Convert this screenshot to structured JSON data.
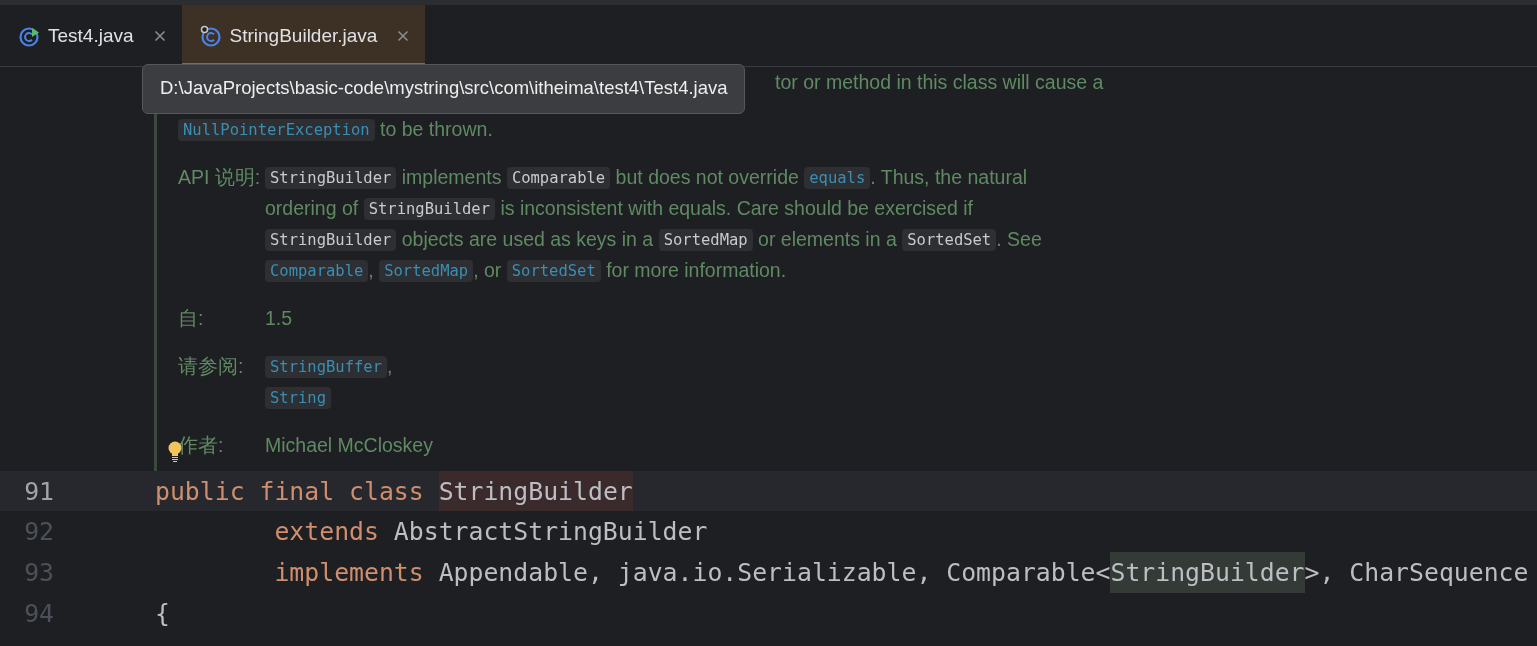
{
  "tabs": [
    {
      "label": "Test4.java",
      "selected": false
    },
    {
      "label": "StringBuilder.java",
      "selected": true
    }
  ],
  "tooltip": {
    "text": "D:\\JavaProjects\\basic-code\\mystring\\src\\com\\itheima\\test4\\Test4.java"
  },
  "doc": {
    "intro_lines": [
      [
        {
          "kind": "text",
          "text": "tor or method in this class will cause a"
        }
      ],
      [
        {
          "kind": "link",
          "text": "NullPointerException"
        },
        {
          "kind": "text",
          "text": " to be thrown."
        }
      ]
    ],
    "sections": [
      {
        "label": "API 说明:",
        "lines": [
          [
            {
              "kind": "code",
              "text": "StringBuilder"
            },
            {
              "kind": "text",
              "text": " implements "
            },
            {
              "kind": "code",
              "text": "Comparable"
            },
            {
              "kind": "text",
              "text": " but does not override "
            },
            {
              "kind": "link",
              "text": "equals"
            },
            {
              "kind": "text",
              "text": ". Thus, the natural"
            }
          ],
          [
            {
              "kind": "text",
              "text": "ordering of "
            },
            {
              "kind": "code",
              "text": "StringBuilder"
            },
            {
              "kind": "text",
              "text": " is inconsistent with equals. Care should be exercised if"
            }
          ],
          [
            {
              "kind": "code",
              "text": "StringBuilder"
            },
            {
              "kind": "text",
              "text": " objects are used as keys in a "
            },
            {
              "kind": "code",
              "text": "SortedMap"
            },
            {
              "kind": "text",
              "text": " or elements in a "
            },
            {
              "kind": "code",
              "text": "SortedSet"
            },
            {
              "kind": "text",
              "text": ". See"
            }
          ],
          [
            {
              "kind": "link",
              "text": "Comparable"
            },
            {
              "kind": "text",
              "text": ", "
            },
            {
              "kind": "link",
              "text": "SortedMap"
            },
            {
              "kind": "text",
              "text": ", or "
            },
            {
              "kind": "link",
              "text": "SortedSet"
            },
            {
              "kind": "text",
              "text": " for more information."
            }
          ]
        ]
      },
      {
        "label": "自:",
        "lines": [
          [
            {
              "kind": "text",
              "text": "1.5"
            }
          ]
        ]
      },
      {
        "label": "请参阅:",
        "lines": [
          [
            {
              "kind": "link",
              "text": "StringBuffer"
            },
            {
              "kind": "text",
              "text": ","
            }
          ],
          [
            {
              "kind": "link",
              "text": "String"
            }
          ]
        ]
      },
      {
        "label": "作者:",
        "lines": [
          [
            {
              "kind": "text",
              "text": "Michael McCloskey"
            }
          ]
        ]
      }
    ]
  },
  "code_lines": [
    {
      "number": "91",
      "current": true,
      "tokens": [
        {
          "kind": "keyword",
          "text": "public final class "
        },
        {
          "kind": "declared",
          "text": "StringBuilder"
        }
      ]
    },
    {
      "number": "92",
      "current": false,
      "indented": true,
      "tokens": [
        {
          "kind": "keyword",
          "text": "extends "
        },
        {
          "kind": "plain",
          "text": "AbstractStringBuilder"
        }
      ]
    },
    {
      "number": "93",
      "current": false,
      "indented": true,
      "tokens": [
        {
          "kind": "keyword",
          "text": "implements "
        },
        {
          "kind": "plain",
          "text": "Appendable, java.io.Serializable, Comparable<"
        },
        {
          "kind": "usage",
          "text": "StringBuilder"
        },
        {
          "kind": "plain",
          "text": ">, CharSequence"
        }
      ]
    },
    {
      "number": "94",
      "current": false,
      "tokens": [
        {
          "kind": "plain",
          "text": "{"
        }
      ]
    }
  ]
}
